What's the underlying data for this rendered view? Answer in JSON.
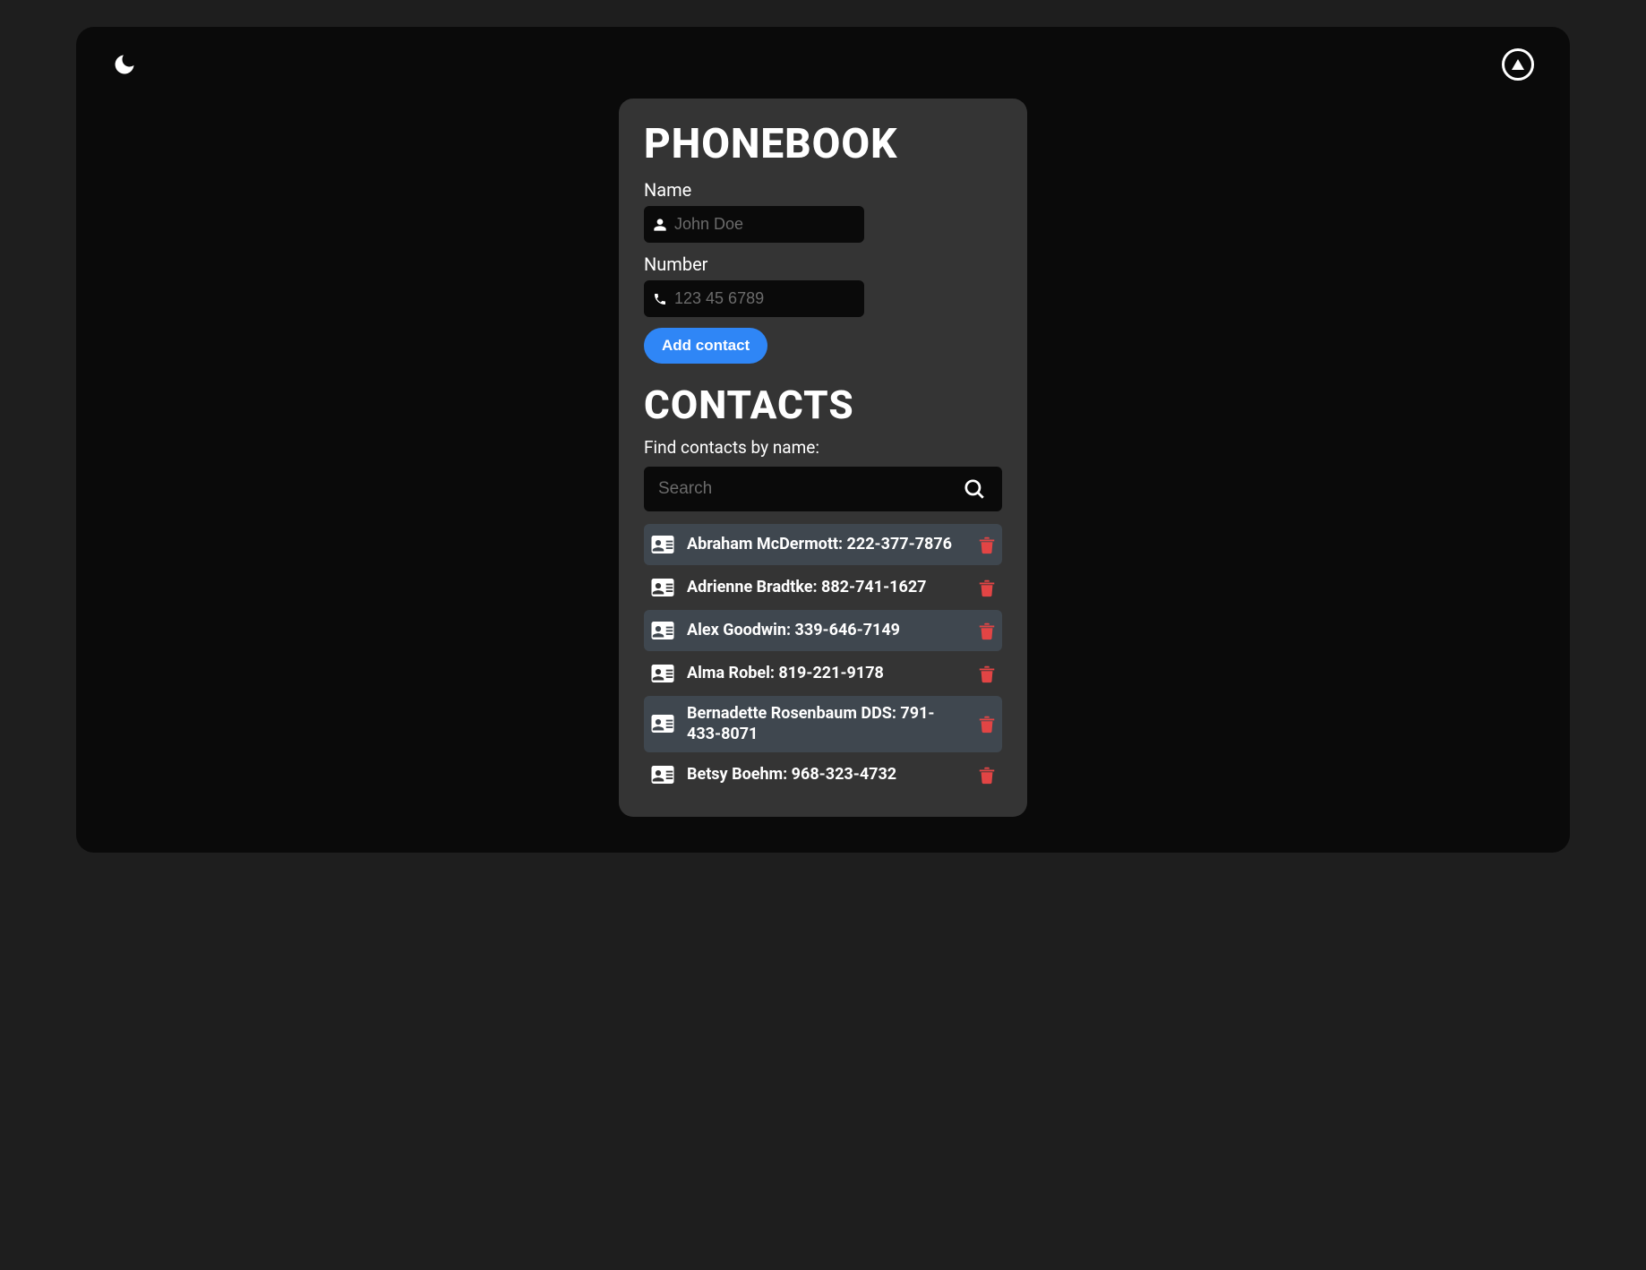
{
  "header": {
    "title": "PHONEBOOK"
  },
  "form": {
    "name_label": "Name",
    "name_placeholder": "John Doe",
    "number_label": "Number",
    "number_placeholder": "123 45 6789",
    "add_button": "Add contact"
  },
  "contacts_section": {
    "title": "CONTACTS",
    "search_label": "Find contacts by name:",
    "search_placeholder": "Search"
  },
  "contacts": [
    {
      "name": "Abraham McDermott",
      "number": "222-377-7876"
    },
    {
      "name": "Adrienne Bradtke",
      "number": "882-741-1627"
    },
    {
      "name": "Alex Goodwin",
      "number": "339-646-7149"
    },
    {
      "name": "Alma Robel",
      "number": "819-221-9178"
    },
    {
      "name": "Bernadette Rosenbaum DDS",
      "number": "791-433-8071"
    },
    {
      "name": "Betsy Boehm",
      "number": "968-323-4732"
    }
  ],
  "icons": {
    "theme": "moon-icon",
    "collapse": "triangle-up-icon",
    "user": "user-icon",
    "phone": "phone-icon",
    "search": "search-icon",
    "card": "contact-card-icon",
    "delete": "trash-icon"
  },
  "colors": {
    "accent": "#2f86f6",
    "danger": "#e24545",
    "panel": "#343434",
    "app_bg": "#0a0a0a",
    "alt_row": "#3f474f"
  }
}
